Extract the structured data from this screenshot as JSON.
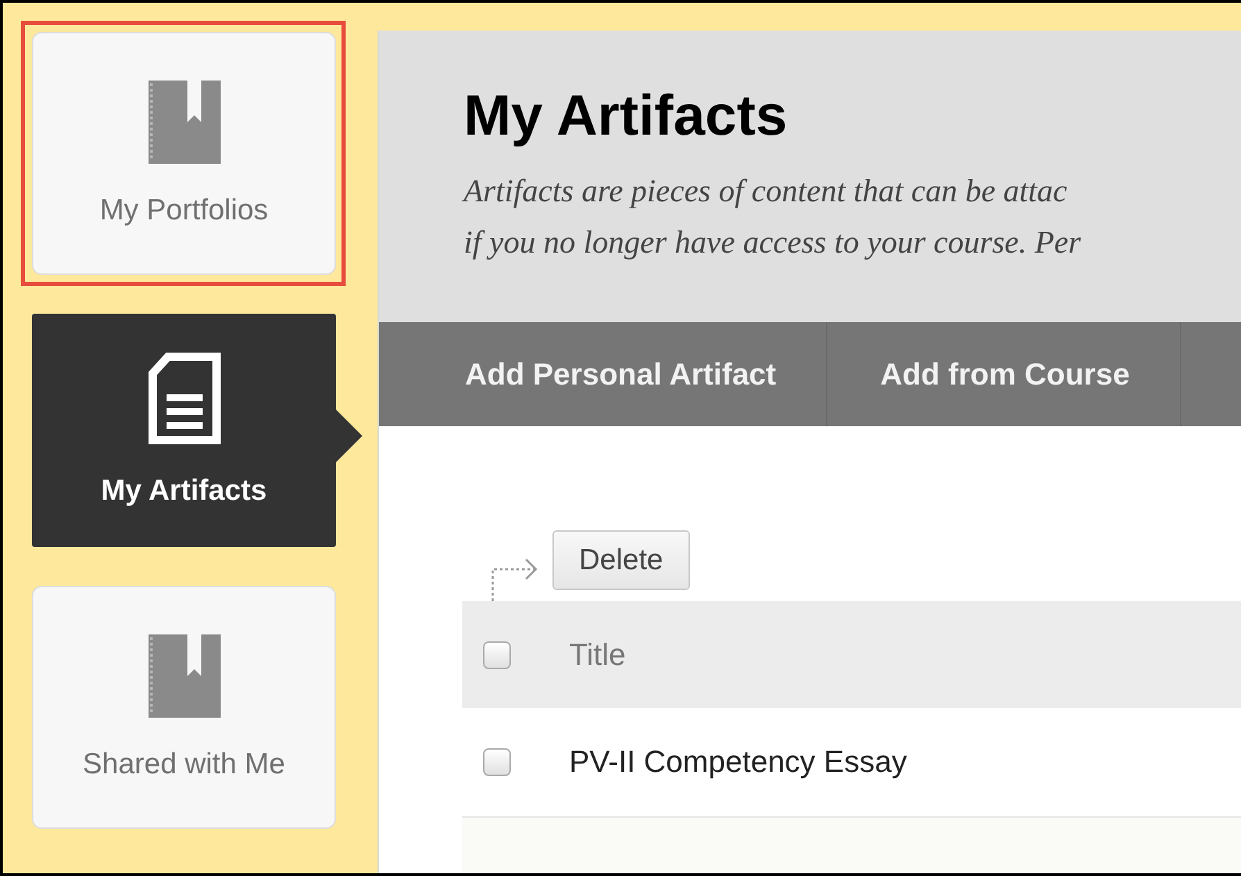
{
  "sidebar": {
    "items": [
      {
        "label": "My Portfolios",
        "kind": "book",
        "selected": false,
        "highlighted": true
      },
      {
        "label": "My Artifacts",
        "kind": "document",
        "selected": true,
        "highlighted": false
      },
      {
        "label": "Shared with Me",
        "kind": "book",
        "selected": false,
        "highlighted": false
      }
    ]
  },
  "header": {
    "title": "My Artifacts",
    "description": [
      "Artifacts are pieces of content that can be attac",
      "if you no longer have access to your course. Per"
    ]
  },
  "toolbar": {
    "buttons": [
      "Add Personal Artifact",
      "Add from Course"
    ]
  },
  "actions": {
    "buttons": [
      "Delete"
    ]
  },
  "table": {
    "columns": [
      {
        "label": "Title",
        "checked": false
      }
    ],
    "rows": [
      {
        "title": "PV-II Competency Essay",
        "checked": false
      }
    ]
  }
}
